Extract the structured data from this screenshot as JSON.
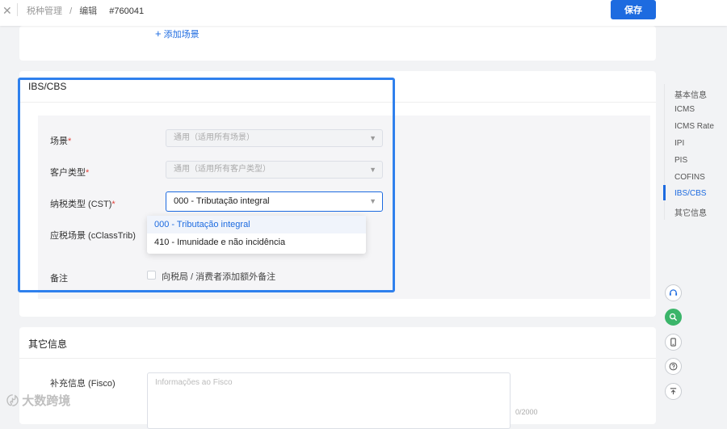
{
  "header": {
    "close_icon": "close-icon",
    "breadcrumb": [
      "税种管理",
      "/",
      "编辑"
    ],
    "record_id": "#760041",
    "save_label": "保存"
  },
  "top_card": {
    "add_scene_label": "添加场景"
  },
  "ibs_section": {
    "title": "IBS/CBS",
    "fields": {
      "scene": {
        "label": "场景",
        "required": "*",
        "placeholder": "通用（适用所有场景）"
      },
      "customer_type": {
        "label": "客户类型",
        "required": "*",
        "placeholder": "通用（适用所有客户类型）"
      },
      "cst": {
        "label": "纳税类型 (CST)",
        "required": "*",
        "value": "000 - Tributação integral"
      },
      "cclasstrib": {
        "label": "应税场景 (cClassTrib)"
      },
      "remark": {
        "label": "备注",
        "checkbox_label": "向税局 / 消费者添加额外备注"
      }
    },
    "cst_options": [
      "000 - Tributação integral",
      "410 - Imunidade e não incidência"
    ],
    "cst_selected_index": 0
  },
  "other_section": {
    "title": "其它信息",
    "fisco_label": "补充信息 (Fisco)",
    "fisco_placeholder": "Informações ao Fisco",
    "counter": "0/2000"
  },
  "right_nav": {
    "items": [
      "基本信息",
      "ICMS",
      "ICMS Rate",
      "IPI",
      "PIS",
      "COFINS",
      "IBS/CBS",
      "其它信息"
    ],
    "active_index": 6
  },
  "floating_tools": [
    "headset-icon",
    "search-icon",
    "mobile-icon",
    "help-icon",
    "back-to-top-icon"
  ],
  "watermark": "大数跨境",
  "colors": {
    "primary": "#1d6be0",
    "required": "#e0413b",
    "highlight": "#2f80ed",
    "tool_green": "#3bb56a"
  }
}
